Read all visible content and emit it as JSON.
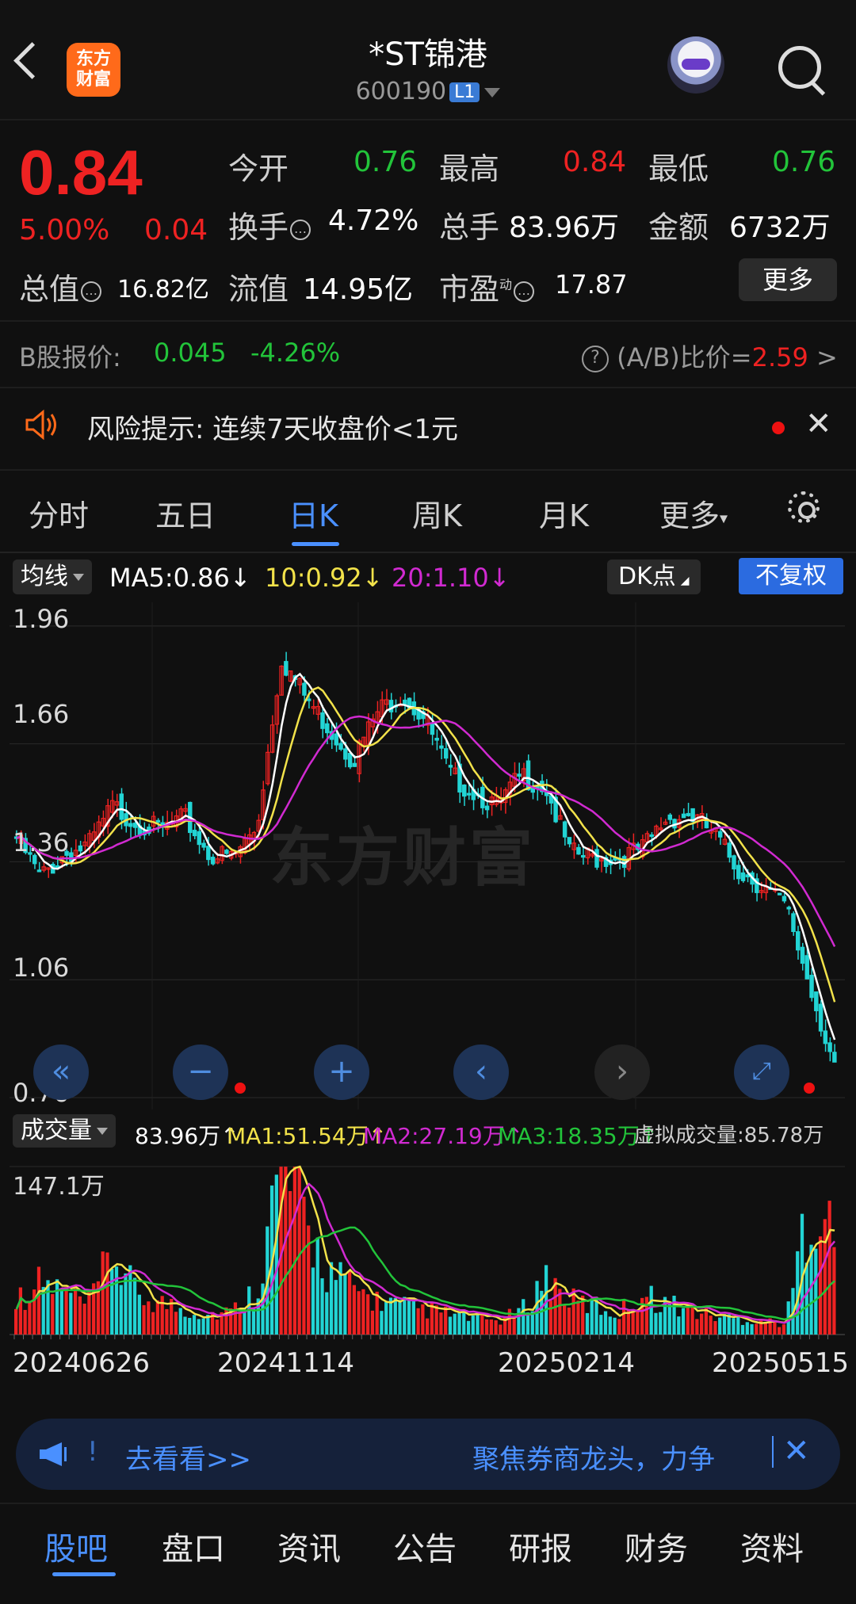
{
  "header": {
    "title": "*ST锦港",
    "stock_code": "600190",
    "level_badge": "L1",
    "logo_line1": "东方",
    "logo_line2": "财富"
  },
  "quote": {
    "price": "0.84",
    "change_pct": "5.00%",
    "change_amt": "0.04",
    "open_label": "今开",
    "open": "0.76",
    "high_label": "最高",
    "high": "0.84",
    "low_label": "最低",
    "low": "0.76",
    "turnover_label": "换手",
    "turnover": "4.72%",
    "volume_label": "总手",
    "volume": "83.96万",
    "amount_label": "金额",
    "amount": "6732万",
    "mktcap_label": "总值",
    "mktcap": "16.82亿",
    "float_label": "流值",
    "float_cap": "14.95亿",
    "pe_label": "市盈",
    "pe_sup": "动",
    "pe": "17.87",
    "more_button": "更多"
  },
  "bshare": {
    "label": "B股报价:",
    "price": "0.045",
    "change": "-4.26%",
    "ratio_label": "(A/B)比价=",
    "ratio": "2.59",
    "arrow": ">"
  },
  "risk": {
    "text": "风险提示:  连续7天收盘价<1元"
  },
  "chart_tabs": [
    "分时",
    "五日",
    "日K",
    "周K",
    "月K",
    "更多"
  ],
  "ma_legend": {
    "select": "均线",
    "ma5": "MA5:0.86↓",
    "ma10": "10:0.92↓",
    "ma20": "20:1.10↓",
    "dk": "DK点",
    "fuquan": "不复权"
  },
  "kline_axis": [
    "1.96",
    "1.66",
    "1.36",
    "1.06",
    "0.76"
  ],
  "watermark": "东方财富",
  "vol_legend": {
    "select": "成交量",
    "vol": "83.96万↑",
    "ma1": "MA1:51.54万↑",
    "ma2": "MA2:27.19万↑",
    "ma3": "MA3:18.35万↑",
    "virtual": "虚拟成交量:85.78万"
  },
  "vol_axis_max": "147.1万",
  "dates": [
    "20240626",
    "20241114",
    "20250214",
    "20250515"
  ],
  "banner": {
    "link": "去看看>>",
    "scroll": "聚焦券商龙头，力争"
  },
  "bottom_tabs": [
    "股吧",
    "盘口",
    "资讯",
    "公告",
    "研报",
    "财务",
    "资料"
  ],
  "colors": {
    "up": "#ee2222",
    "down": "#22d4d4",
    "ma5": "#ffffff",
    "ma10": "#f2e24a",
    "ma20": "#d12ad1",
    "accent": "#4a90ff",
    "vma3": "#22c43a"
  },
  "chart_data": [
    {
      "type": "candlestick",
      "title": "",
      "ylim": [
        0.76,
        2.0
      ],
      "y_ticks": [
        1.96,
        1.66,
        1.36,
        1.06,
        0.76
      ],
      "x_ticks": [
        "20240626",
        "20241114",
        "20250214",
        "20250515"
      ],
      "series": [
        {
          "name": "MA5",
          "last": 0.86
        },
        {
          "name": "MA10",
          "last": 0.92
        },
        {
          "name": "MA20",
          "last": 1.1
        }
      ],
      "close_trend": [
        1.42,
        1.32,
        1.38,
        1.4,
        1.5,
        1.46,
        1.44,
        1.47,
        1.38,
        1.37,
        1.45,
        1.88,
        1.78,
        1.7,
        1.62,
        1.74,
        1.79,
        1.72,
        1.58,
        1.54,
        1.5,
        1.58,
        1.55,
        1.38,
        1.37,
        1.37,
        1.39,
        1.47,
        1.48,
        1.43,
        1.34,
        1.3,
        1.24,
        1.04,
        0.84
      ]
    },
    {
      "type": "bar",
      "title": "成交量",
      "ylim": [
        0,
        147.1
      ],
      "unit": "万",
      "series": [
        {
          "name": "VOL",
          "last": 83.96
        },
        {
          "name": "MA1",
          "last": 51.54
        },
        {
          "name": "MA2",
          "last": 27.19
        },
        {
          "name": "MA3",
          "last": 18.35
        }
      ],
      "volumes_trend": [
        30,
        45,
        38,
        25,
        70,
        35,
        28,
        22,
        18,
        20,
        40,
        147,
        95,
        55,
        40,
        30,
        25,
        22,
        18,
        15,
        12,
        20,
        50,
        30,
        25,
        18,
        35,
        28,
        22,
        16,
        14,
        12,
        10,
        120,
        84
      ]
    }
  ]
}
